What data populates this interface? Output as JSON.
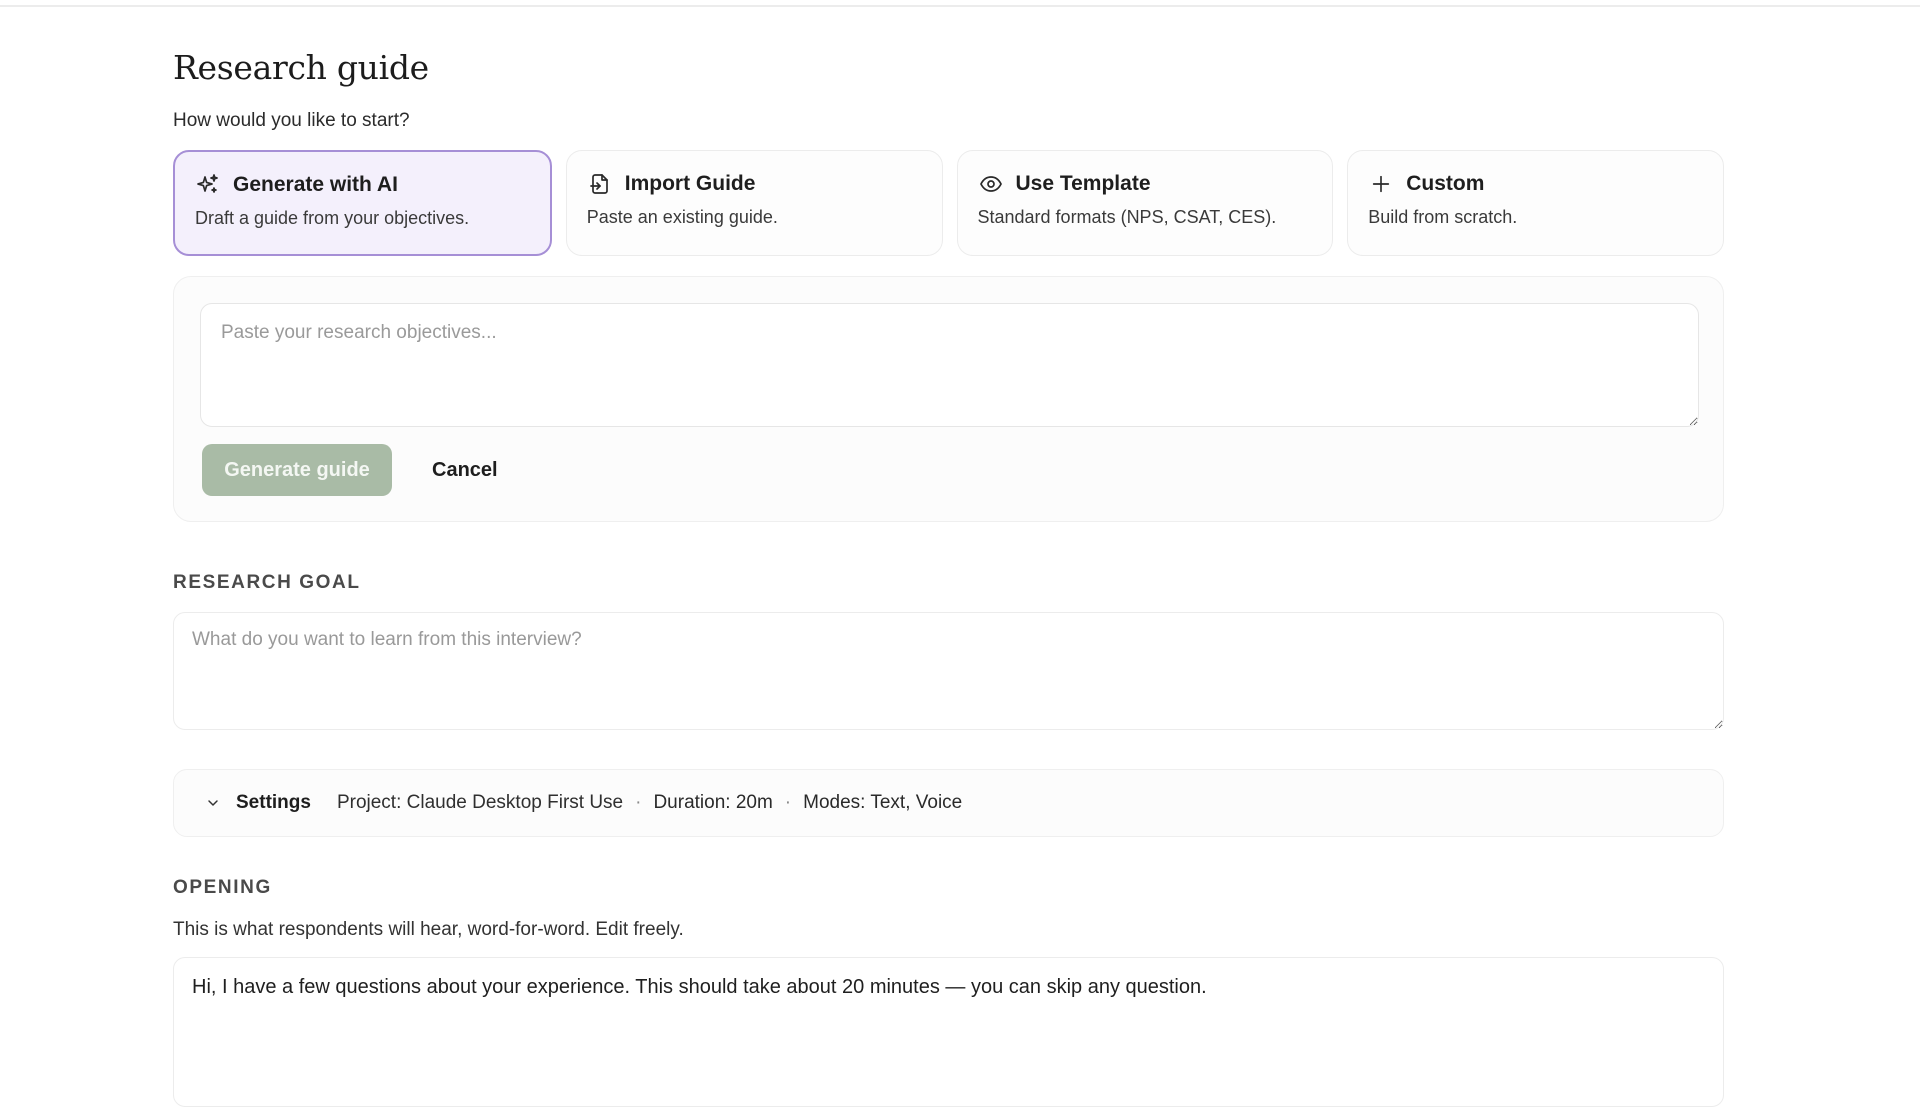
{
  "page": {
    "title": "Research guide",
    "start_prompt": "How would you like to start?"
  },
  "options": [
    {
      "icon": "sparkles-icon",
      "title": "Generate with AI",
      "description": "Draft a guide from your objectives.",
      "selected": true
    },
    {
      "icon": "import-document-icon",
      "title": "Import Guide",
      "description": "Paste an existing guide.",
      "selected": false
    },
    {
      "icon": "eye-icon",
      "title": "Use Template",
      "description": "Standard formats (NPS, CSAT, CES).",
      "selected": false
    },
    {
      "icon": "plus-icon",
      "title": "Custom",
      "description": "Build from scratch.",
      "selected": false
    }
  ],
  "generator": {
    "objectives_placeholder": "Paste your research objectives...",
    "objectives_value": "",
    "generate_label": "Generate guide",
    "cancel_label": "Cancel"
  },
  "research_goal": {
    "label": "RESEARCH GOAL",
    "placeholder": "What do you want to learn from this interview?",
    "value": ""
  },
  "settings": {
    "label": "Settings",
    "project": "Project: Claude Desktop First Use",
    "duration": "Duration: 20m",
    "modes": "Modes: Text, Voice",
    "separator": "·"
  },
  "opening": {
    "label": "OPENING",
    "hint": "This is what respondents will hear, word-for-word. Edit freely.",
    "value": "Hi, I have a few questions about your experience. This should take about 20 minutes — you can skip any question."
  },
  "colors": {
    "selected_border": "#a68fd6",
    "selected_bg": "#f4f0fc",
    "primary_disabled": "#a9bba6"
  }
}
